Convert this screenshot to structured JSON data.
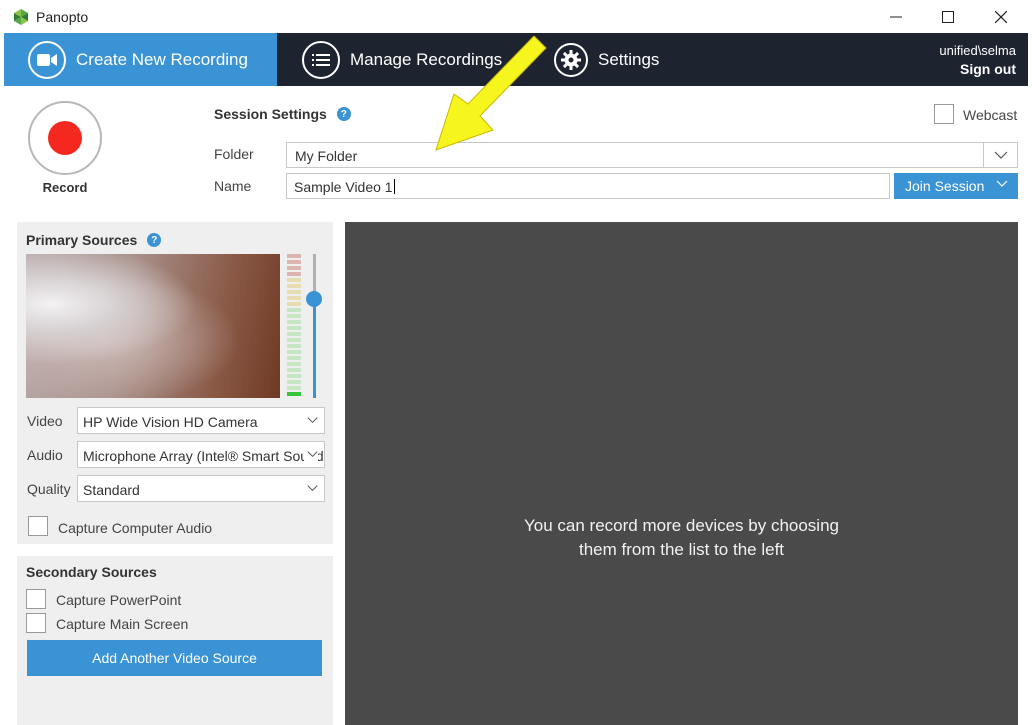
{
  "window": {
    "app_name": "Panopto",
    "minimize_glyph": "—",
    "maximize_glyph": "☐",
    "close_glyph": "✕"
  },
  "nav": {
    "tabs": [
      {
        "label": "Create New Recording",
        "icon": "video-camera-icon",
        "active": true
      },
      {
        "label": "Manage Recordings",
        "icon": "list-icon",
        "active": false
      },
      {
        "label": "Settings",
        "icon": "gear-icon",
        "active": false
      }
    ],
    "user": "unified\\selma",
    "sign_out": "Sign out"
  },
  "record": {
    "label": "Record"
  },
  "session": {
    "title": "Session Settings",
    "help": "?",
    "webcast_label": "Webcast",
    "folder_label": "Folder",
    "folder_value": "My Folder",
    "name_label": "Name",
    "name_value": "Sample Video 1",
    "join_label": "Join Session"
  },
  "primary": {
    "title": "Primary Sources",
    "help": "?",
    "volume_level": 0.69,
    "video_label": "Video",
    "video_value": "HP Wide Vision HD Camera",
    "audio_label": "Audio",
    "audio_value": "Microphone Array (Intel® Smart Sound",
    "quality_label": "Quality",
    "quality_value": "Standard",
    "capture_audio_label": "Capture Computer Audio"
  },
  "secondary": {
    "title": "Secondary Sources",
    "capture_ppt_label": "Capture PowerPoint",
    "capture_screen_label": "Capture Main Screen",
    "add_source_label": "Add Another Video Source"
  },
  "main": {
    "message_line1": "You can record more devices by choosing",
    "message_line2": "them from the list to the left"
  },
  "colors": {
    "accent": "#3a93d5",
    "nav_bg": "#1e2330",
    "record_red": "#f5281f",
    "preview_bg": "#4a4a4a",
    "arrow_yellow": "#f7f51e"
  }
}
